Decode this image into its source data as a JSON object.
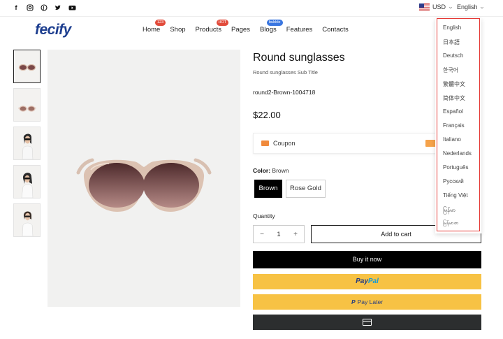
{
  "topbar": {
    "social_icons": [
      "facebook-icon",
      "instagram-icon",
      "pinterest-icon",
      "twitter-icon",
      "youtube-icon"
    ],
    "currency": "USD",
    "language": "English"
  },
  "header": {
    "logo": "fecify",
    "nav": [
      {
        "label": "Home",
        "badge": "123"
      },
      {
        "label": "Shop",
        "badge": ""
      },
      {
        "label": "Products",
        "badge": "HOT"
      },
      {
        "label": "Pages",
        "badge": ""
      },
      {
        "label": "Blogs",
        "badge": "bubble"
      },
      {
        "label": "Features",
        "badge": ""
      },
      {
        "label": "Contacts",
        "badge": ""
      }
    ]
  },
  "product": {
    "title": "Round sunglasses",
    "subtitle": "Round sunglasses Sub Title",
    "sku": "round2-Brown-1004718",
    "price": "$22.00",
    "coupon_label": "Coupon",
    "color_label": "Color:",
    "color_value": "Brown",
    "color_options": [
      "Brown",
      "Rose Gold"
    ],
    "quantity_label": "Quantity",
    "quantity": "1",
    "minus": "−",
    "plus": "+",
    "add_to_cart": "Add to cart",
    "buy_now": "Buy it now",
    "paypal_pay": "Pay",
    "paypal_pal": "Pal",
    "paypal_p": "P",
    "pay_later": "Pay Later"
  },
  "language_dropdown": {
    "items": [
      "English",
      "日本語",
      "Deutsch",
      "한국어",
      "繁體中文",
      "简体中文",
      "Español",
      "Français",
      "Italiano",
      "Nederlands",
      "Português",
      "Русский",
      "Tiếng Việt",
      "မြန်မာ",
      "မြန်မာစာ"
    ]
  },
  "colors": {
    "brand": "#1d3e8f",
    "accent": "#f2a71b",
    "paypal_yellow": "#f7c244",
    "highlight_outline": "#e53935"
  }
}
